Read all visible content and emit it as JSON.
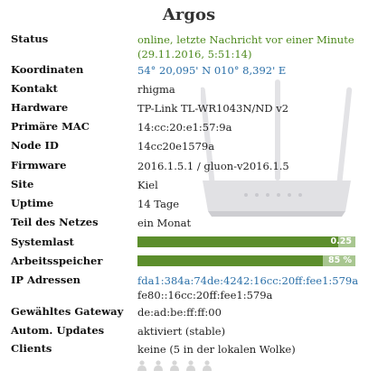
{
  "title": "Argos",
  "rows": {
    "status": {
      "label": "Status",
      "line1": "online, letzte Nachricht vor einer Minute",
      "line2": "(29.11.2016, 5:51:14)"
    },
    "coords": {
      "label": "Koordinaten",
      "value": "54° 20,095' N 010° 8,392' E"
    },
    "contact": {
      "label": "Kontakt",
      "value": "rhigma"
    },
    "hardware": {
      "label": "Hardware",
      "value": "TP-Link TL-WR1043N/ND v2"
    },
    "mac": {
      "label": "Primäre MAC",
      "value": "14:cc:20:e1:57:9a"
    },
    "nodeid": {
      "label": "Node ID",
      "value": "14cc20e1579a"
    },
    "firmware": {
      "label": "Firmware",
      "value": "2016.1.5.1 / gluon-v2016.1.5"
    },
    "site": {
      "label": "Site",
      "value": "Kiel"
    },
    "uptime": {
      "label": "Uptime",
      "value": "14 Tage"
    },
    "partof": {
      "label": "Teil des Netzes",
      "value": "ein Monat"
    },
    "load": {
      "label": "Systemlast",
      "text": "0.25",
      "fraction": 0.92
    },
    "memory": {
      "label": "Arbeitsspeicher",
      "text": "85 %",
      "fraction": 0.85
    },
    "ip": {
      "label": "IP Adressen",
      "line1": "fda1:384a:74de:4242:16cc:20ff:fee1:579a",
      "line2": "fe80::16cc:20ff:fee1:579a"
    },
    "gateway": {
      "label": "Gewähltes Gateway",
      "value": "de:ad:be:ff:ff:00"
    },
    "autoupdate": {
      "label": "Autom. Updates",
      "value": "aktiviert (stable)"
    },
    "clients": {
      "label": "Clients",
      "value": "keine (5 in der lokalen Wolke)"
    }
  },
  "colors": {
    "status_green": "#4e8a1e",
    "link_blue": "#2a6fa8",
    "bar_dark": "#5c8e2c",
    "bar_light": "#a8c690"
  },
  "icons": {
    "router": "router-image",
    "clients": "person-icon"
  }
}
